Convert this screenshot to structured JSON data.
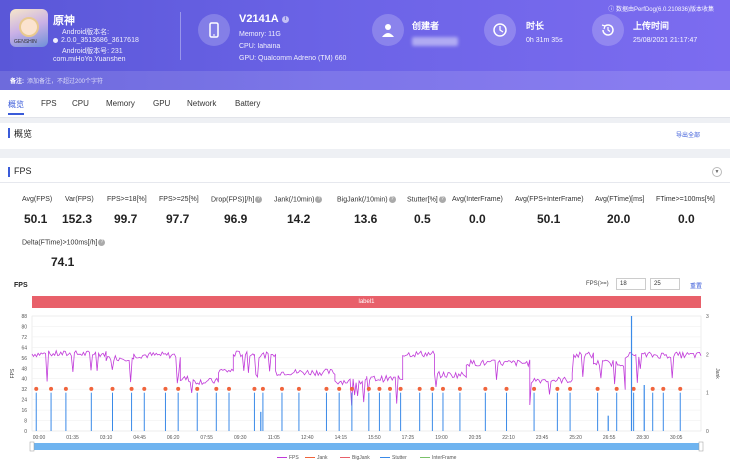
{
  "colors": {
    "header_start": "#5a57d8",
    "accent": "#3a5bd9",
    "fps_line": "#c03ad9",
    "jank": "#f0643c",
    "bigjank": "#e8606a",
    "stutter": "#3a8ae8",
    "interframe": "#7bc26a",
    "label_bar": "#e8606a"
  },
  "app": {
    "name": "原神",
    "version_label": "Android版本名:",
    "version": "2.0.0_3513686_3617618",
    "version_code": "Android版本号: 231",
    "package": "com.miHoYo.Yuanshen",
    "icon": "genshin-app-icon"
  },
  "device": {
    "name": "V2141A",
    "memory": "Memory: 11G",
    "cpu": "CPU: lahaina",
    "gpu": "GPU: Qualcomm Adreno (TM) 660",
    "icon": "phone-icon"
  },
  "creator": {
    "title": "创建者",
    "icon": "user-icon"
  },
  "duration": {
    "title": "时长",
    "value": "0h 31m 35s",
    "icon": "clock-icon"
  },
  "upload": {
    "title": "上传时间",
    "value": "25/08/2021 21:17:47",
    "icon": "history-icon",
    "version_note": "数据由PerfDog(6.0.210836)版本收集"
  },
  "remark": {
    "label": "备注:",
    "placeholder": "添加备注，不超过200个字符"
  },
  "tabs": [
    "概览",
    "FPS",
    "CPU",
    "Memory",
    "GPU",
    "Network",
    "Battery"
  ],
  "overview": {
    "title": "概览",
    "export": "导出全部"
  },
  "fps_section": {
    "title": "FPS"
  },
  "metrics": [
    {
      "label": "Avg(FPS)",
      "value": "50.1"
    },
    {
      "label": "Var(FPS)",
      "value": "152.3"
    },
    {
      "label": "FPS>=18[%]",
      "value": "99.7"
    },
    {
      "label": "FPS>=25[%]",
      "value": "97.7"
    },
    {
      "label": "Drop(FPS)[/h]",
      "value": "96.9"
    },
    {
      "label": "Jank(/10min)",
      "value": "14.2"
    },
    {
      "label": "BigJank(/10min)",
      "value": "13.6"
    },
    {
      "label": "Stutter[%]",
      "value": "0.5"
    },
    {
      "label": "Avg(InterFrame)",
      "value": "0.0"
    },
    {
      "label": "Avg(FPS+InterFrame)",
      "value": "50.1"
    },
    {
      "label": "Avg(FTime)[ms]",
      "value": "20.0"
    },
    {
      "label": "FTime>=100ms[%]",
      "value": "0.0"
    },
    {
      "label": "Delta(FTime)>100ms[/h]",
      "value": "74.1"
    }
  ],
  "chart_controls": {
    "title": "FPS",
    "filter_label": "FPS(>=)",
    "min1": "18",
    "min2": "25",
    "reset": "重置",
    "label_bar": "label1"
  },
  "chart_data": {
    "type": "line",
    "ylabel": "FPS",
    "y2label": "Jank",
    "ylim": [
      0,
      88
    ],
    "y2lim": [
      0,
      3
    ],
    "yticks": [
      "0",
      "8",
      "16",
      "24",
      "32",
      "40",
      "48",
      "56",
      "64",
      "72",
      "80",
      "88"
    ],
    "y2ticks": [
      "0",
      "1",
      "2",
      "3"
    ],
    "xticks": [
      "00:00",
      "01:35",
      "03:10",
      "04:45",
      "06:20",
      "07:55",
      "09:30",
      "11:05",
      "12:40",
      "14:15",
      "15:50",
      "17:25",
      "19:00",
      "20:35",
      "22:10",
      "23:45",
      "25:20",
      "26:55",
      "28:30",
      "30:05"
    ],
    "x_range_min": [
      0,
      31.58
    ],
    "fps_segments": [
      {
        "x": [
          0,
          3.5
        ],
        "y": 59
      },
      {
        "x": [
          3.5,
          4.8
        ],
        "y": 56
      },
      {
        "x": [
          4.8,
          7.0
        ],
        "y": 58
      },
      {
        "x": [
          7.0,
          7.4
        ],
        "y": 40
      },
      {
        "x": [
          7.4,
          8.8
        ],
        "y": 38
      },
      {
        "x": [
          8.8,
          9.5
        ],
        "y": 46
      },
      {
        "x": [
          9.5,
          10.5
        ],
        "y": 59
      },
      {
        "x": [
          10.5,
          11.5
        ],
        "y": 58
      },
      {
        "x": [
          11.5,
          14.3
        ],
        "y": 45
      },
      {
        "x": [
          14.3,
          15.8
        ],
        "y": 38
      },
      {
        "x": [
          15.8,
          17.5
        ],
        "y": 40
      },
      {
        "x": [
          17.5,
          19.0
        ],
        "y": 59
      },
      {
        "x": [
          19.0,
          20.5
        ],
        "y": 43
      },
      {
        "x": [
          20.5,
          23.5
        ],
        "y": 52
      },
      {
        "x": [
          23.5,
          25.5
        ],
        "y": 39
      },
      {
        "x": [
          25.5,
          26.5
        ],
        "y": 58
      },
      {
        "x": [
          26.5,
          28.0
        ],
        "y": 52
      },
      {
        "x": [
          28.0,
          31.58
        ],
        "y": 58
      }
    ],
    "jank_minutes": [
      0.2,
      0.9,
      1.6,
      2.8,
      3.8,
      4.7,
      5.3,
      6.3,
      6.9,
      7.8,
      8.7,
      9.3,
      10.5,
      10.9,
      11.8,
      12.6,
      13.9,
      14.5,
      15.1,
      15.9,
      16.4,
      16.9,
      17.4,
      18.3,
      18.9,
      19.4,
      20.2,
      21.4,
      22.4,
      23.7,
      24.8,
      25.4,
      26.7,
      27.6,
      28.4,
      29.3,
      29.8,
      30.6
    ],
    "stutter_minutes": [
      {
        "x": 28.3,
        "y": 3.0
      },
      {
        "x": 28.9,
        "y": 1.2
      },
      {
        "x": 10.8,
        "y": 0.5
      },
      {
        "x": 27.2,
        "y": 0.4
      }
    ],
    "legend": [
      "FPS",
      "Jank",
      "BigJank",
      "Stutter",
      "InterFrame"
    ]
  }
}
